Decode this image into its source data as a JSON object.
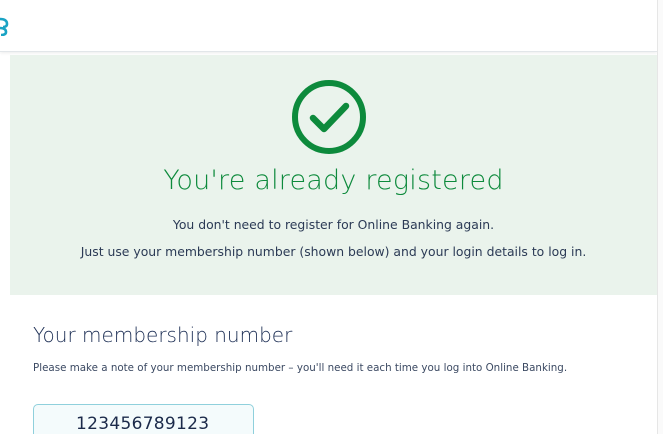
{
  "header": {
    "logo_icon": "brand-logo-fragment-icon"
  },
  "success": {
    "icon": "check-circle-icon",
    "title": "You're already registered",
    "line1": "You don't need to register for Online Banking again.",
    "line2": "Just use your membership number (shown below) and your login details to log in.",
    "accent_color": "#0d8a3c",
    "panel_color": "#eaf3ec"
  },
  "membership": {
    "heading": "Your membership number",
    "note": "Please make a note of your membership number – you'll need it each time you log into Online Banking.",
    "number": "123456789123"
  }
}
